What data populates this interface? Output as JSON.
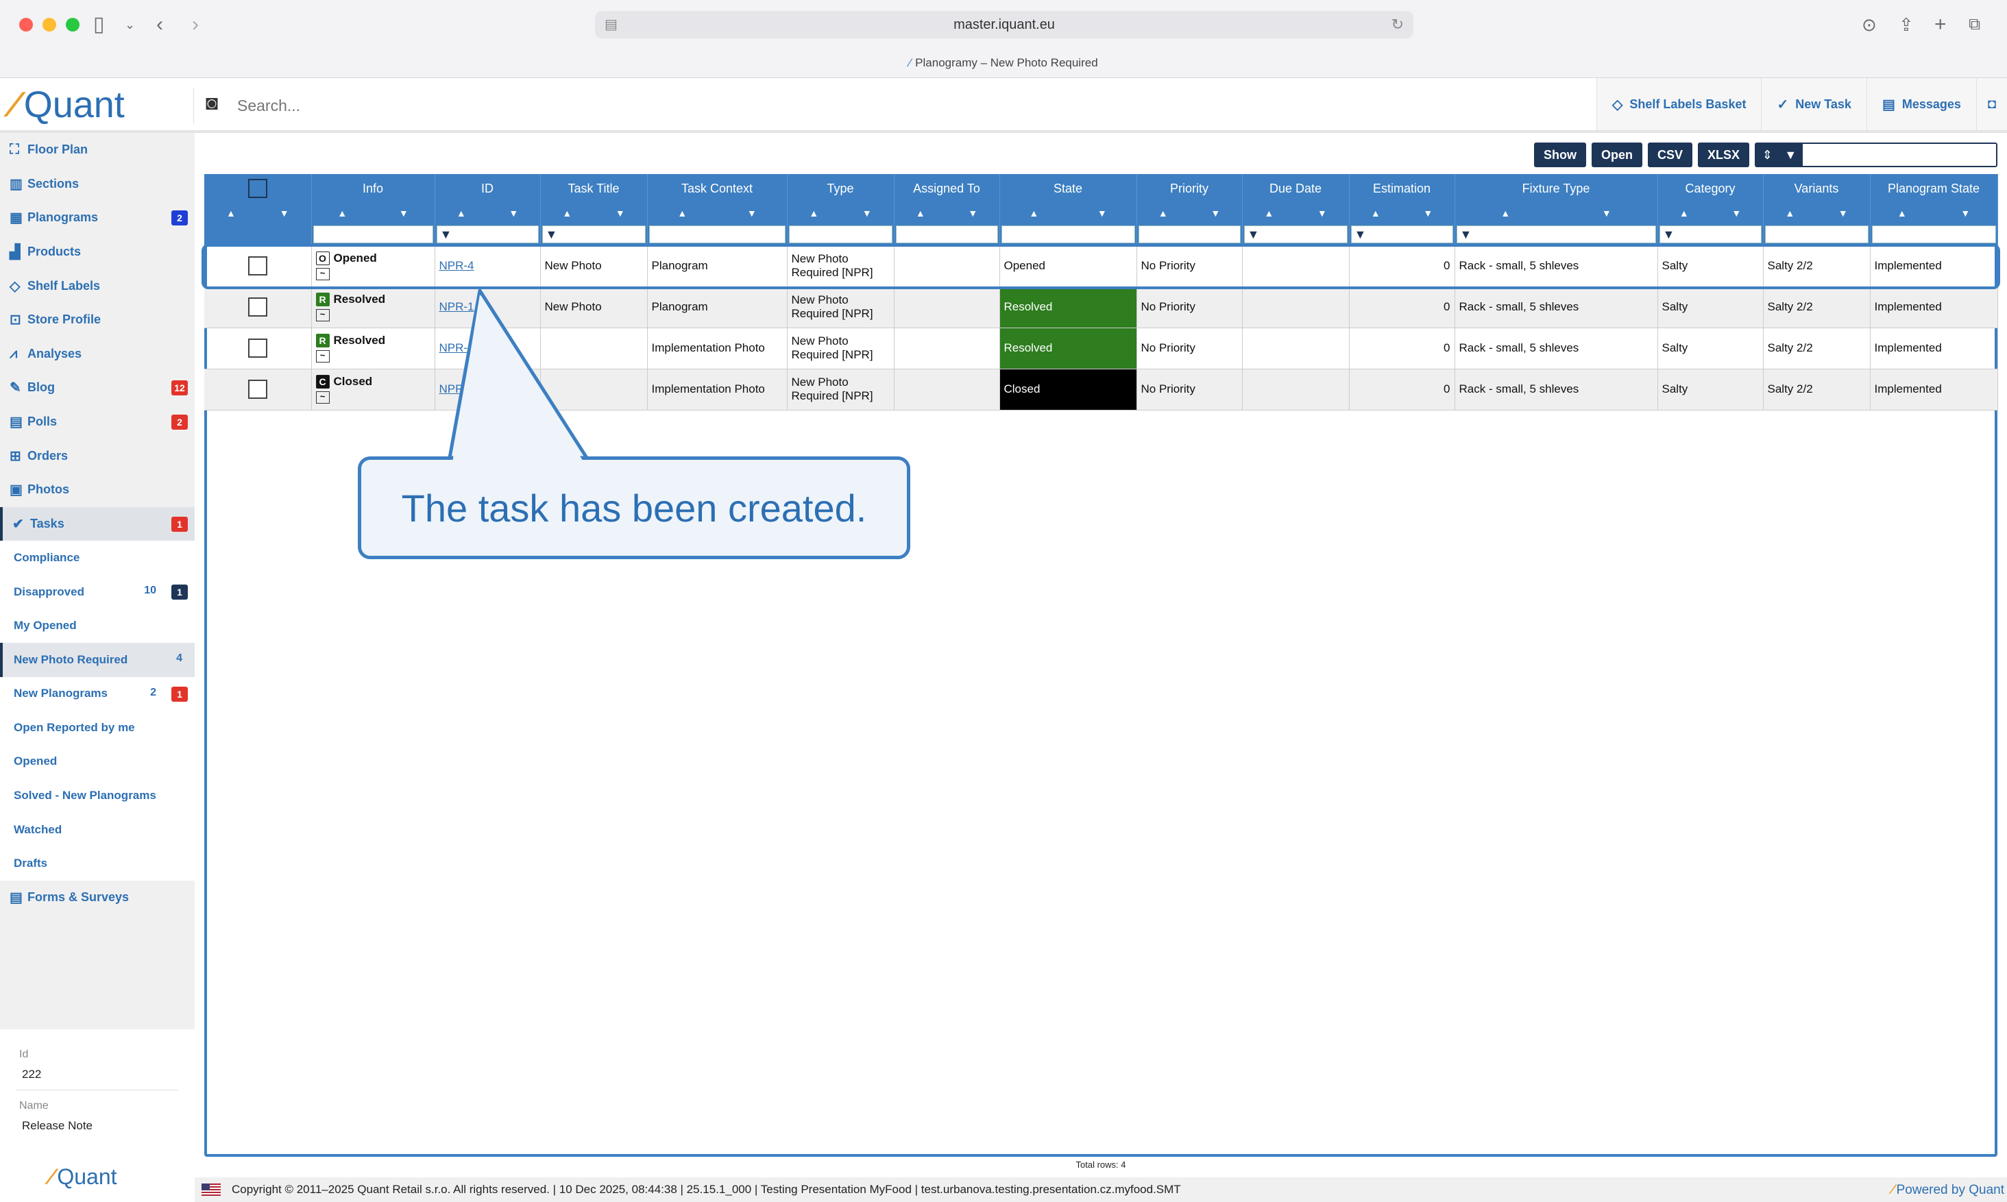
{
  "browser": {
    "url": "master.iquant.eu",
    "tab_title": "Planogramy – New Photo Required"
  },
  "header": {
    "logo": "Quant",
    "search_placeholder": "Search...",
    "buttons": [
      {
        "label": "Shelf Labels Basket",
        "icon": "tag-icon"
      },
      {
        "label": "New Task",
        "icon": "check-circle-icon"
      },
      {
        "label": "Messages",
        "icon": "messages-icon"
      }
    ]
  },
  "sidebar": {
    "items": [
      {
        "label": "Floor Plan",
        "icon": "floorplan-icon"
      },
      {
        "label": "Sections",
        "icon": "sections-icon"
      },
      {
        "label": "Planograms",
        "icon": "planograms-icon",
        "badge": "2"
      },
      {
        "label": "Products",
        "icon": "products-icon"
      },
      {
        "label": "Shelf Labels",
        "icon": "tag-icon"
      },
      {
        "label": "Store Profile",
        "icon": "store-icon"
      },
      {
        "label": "Analyses",
        "icon": "analyses-icon"
      },
      {
        "label": "Blog",
        "icon": "blog-icon",
        "badge": "12"
      },
      {
        "label": "Polls",
        "icon": "polls-icon",
        "badge": "2"
      },
      {
        "label": "Orders",
        "icon": "orders-icon"
      },
      {
        "label": "Photos",
        "icon": "photos-icon"
      },
      {
        "label": "Tasks",
        "icon": "tasks-icon",
        "badge": "1"
      }
    ],
    "subitems": [
      {
        "label": "Compliance"
      },
      {
        "label": "Disapproved",
        "count": "10",
        "badge": "1"
      },
      {
        "label": "My Opened"
      },
      {
        "label": "New Photo Required",
        "count": "4"
      },
      {
        "label": "New Planograms",
        "count": "2",
        "badge": "1"
      },
      {
        "label": "Open Reported by me"
      },
      {
        "label": "Opened"
      },
      {
        "label": "Solved - New Planograms"
      },
      {
        "label": "Watched"
      },
      {
        "label": "Drafts"
      }
    ],
    "forms": {
      "label": "Forms & Surveys"
    },
    "bottom": {
      "id_label": "Id",
      "id_value": "222",
      "name_label": "Name",
      "name_value": "Release Note",
      "logo": "Quant"
    }
  },
  "toolbar": {
    "show": "Show",
    "open": "Open",
    "csv": "CSV",
    "xlsx": "XLSX"
  },
  "table": {
    "columns": [
      "Info",
      "ID",
      "Task Title",
      "Task Context",
      "Type",
      "Assigned To",
      "State",
      "Priority",
      "Due Date",
      "Estimation",
      "Fixture Type",
      "Category",
      "Variants",
      "Planogram State"
    ],
    "rows": [
      {
        "badge": "O",
        "info": "Opened",
        "id": "NPR-4",
        "title": "New Photo",
        "context": "Planogram",
        "type1": "New Photo",
        "type2": "Required [NPR]",
        "assigned": "",
        "state": "Opened",
        "priority": "No Priority",
        "due": "",
        "estimation": "0",
        "fixture": "Rack - small, 5 shleves",
        "category": "Salty",
        "variants": "Salty 2/2",
        "pstate": "Implemented"
      },
      {
        "badge": "R",
        "info": "Resolved",
        "id": "NPR-1",
        "title": "New Photo",
        "context": "Planogram",
        "type1": "New Photo",
        "type2": "Required [NPR]",
        "assigned": "",
        "state": "Resolved",
        "priority": "No Priority",
        "due": "",
        "estimation": "0",
        "fixture": "Rack - small, 5 shleves",
        "category": "Salty",
        "variants": "Salty 2/2",
        "pstate": "Implemented"
      },
      {
        "badge": "R",
        "info": "Resolved",
        "id": "NPR-",
        "title": "",
        "context": "Implementation Photo",
        "type1": "New Photo",
        "type2": "Required [NPR]",
        "assigned": "",
        "state": "Resolved",
        "priority": "No Priority",
        "due": "",
        "estimation": "0",
        "fixture": "Rack - small, 5 shleves",
        "category": "Salty",
        "variants": "Salty 2/2",
        "pstate": "Implemented"
      },
      {
        "badge": "C",
        "info": "Closed",
        "id": "NPR",
        "title": "",
        "context": "Implementation Photo",
        "type1": "New Photo",
        "type2": "Required [NPR]",
        "assigned": "",
        "state": "Closed",
        "priority": "No Priority",
        "due": "",
        "estimation": "0",
        "fixture": "Rack - small, 5 shleves",
        "category": "Salty",
        "variants": "Salty 2/2",
        "pstate": "Implemented"
      }
    ],
    "total_rows": "Total rows: 4"
  },
  "callout": {
    "text": "The task has been created."
  },
  "footer": {
    "copyright": "Copyright © 2011–2025 Quant Retail s.r.o. All rights reserved. | 10 Dec 2025, 08:44:38 | 25.15.1_000 | Testing Presentation MyFood | test.urbanova.testing.presentation.cz.myfood.SMT",
    "powered": "Powered by Quant"
  },
  "colors": {
    "accent": "#3d7fc2",
    "navy": "#1d3557",
    "resolved": "#2e7d1f",
    "badge_red": "#e2342a"
  }
}
